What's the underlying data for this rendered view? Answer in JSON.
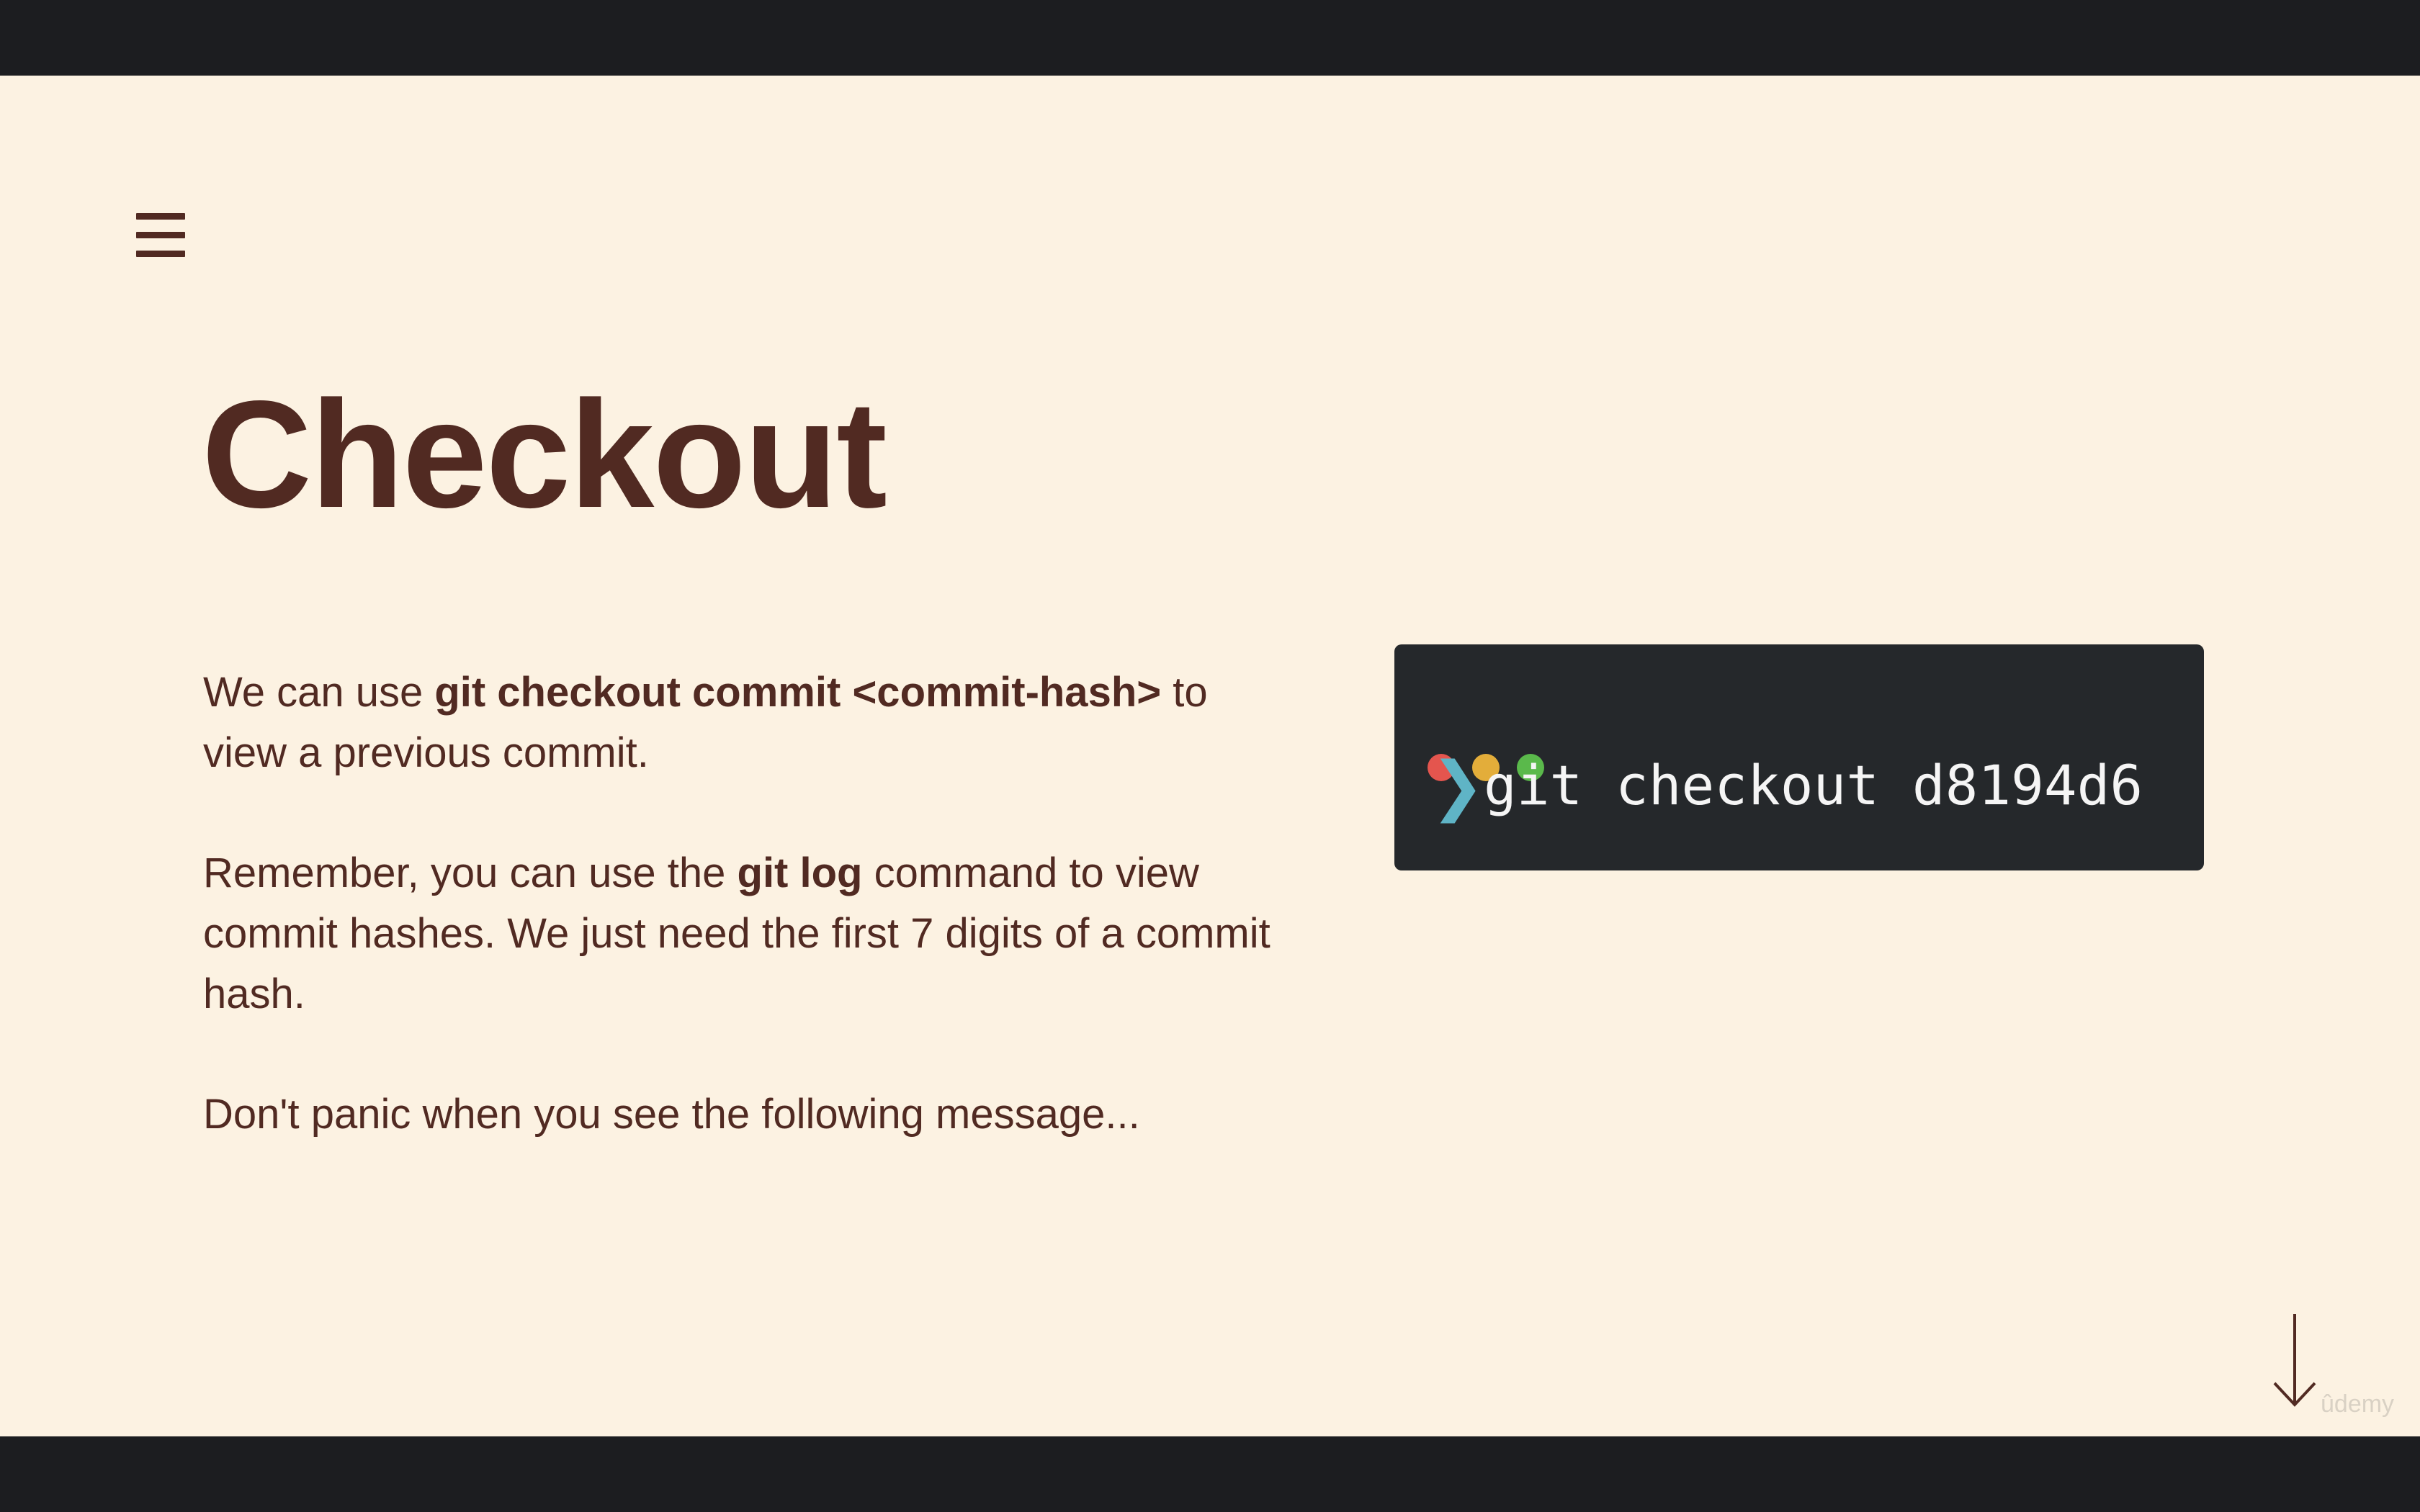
{
  "slide": {
    "title": "Checkout",
    "paragraphs": [
      {
        "segments": [
          {
            "text": "We can use ",
            "bold": false
          },
          {
            "text": "git checkout commit",
            "bold": true
          },
          {
            "text": " ",
            "bold": false
          },
          {
            "text": "<commit-hash>",
            "bold": true
          },
          {
            "text": " to view a previous commit.",
            "bold": false
          }
        ]
      },
      {
        "segments": [
          {
            "text": "Remember, you can use the ",
            "bold": false
          },
          {
            "text": "git log",
            "bold": true
          },
          {
            "text": " command to view commit hashes.  We just need the first 7 digits of a commit hash.",
            "bold": false
          }
        ]
      },
      {
        "segments": [
          {
            "text": "Don't panic when you see the following message...",
            "bold": false
          }
        ]
      }
    ]
  },
  "terminal": {
    "prompt": "❯",
    "command": "git checkout d8194d6",
    "window_dots": [
      "red",
      "yellow",
      "green"
    ]
  },
  "navigation": {
    "menu_icon": "hamburger-menu-icon",
    "next_icon": "down-arrow-icon"
  },
  "watermark": "ûdemy",
  "colors": {
    "background": "#fcf2e2",
    "text": "#512a22",
    "letterbox": "#1c1d20",
    "terminal_bg": "#25282b",
    "prompt": "#5fb4c6",
    "dot_red": "#e4554e",
    "dot_yellow": "#e3ad3a",
    "dot_green": "#5ab94b"
  }
}
